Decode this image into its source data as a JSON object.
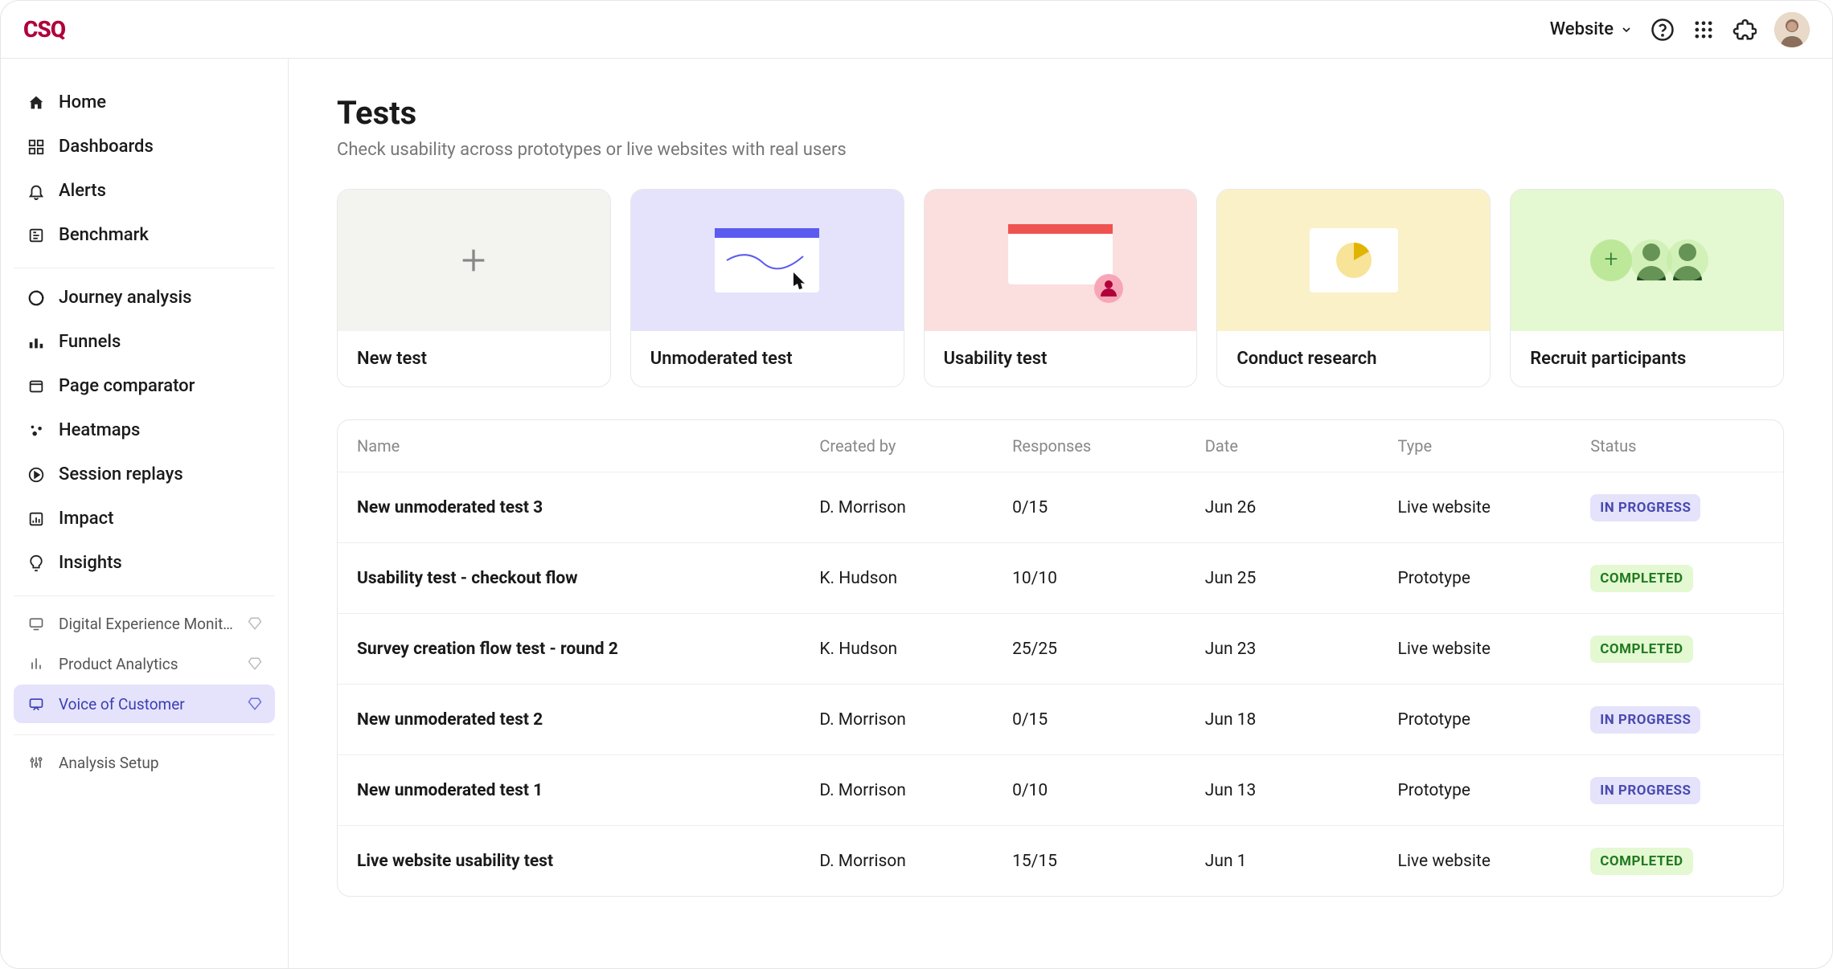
{
  "header": {
    "brand": "CSQ",
    "project_selector": "Website"
  },
  "sidebar": {
    "groups": [
      {
        "items": [
          {
            "id": "home",
            "label": "Home"
          },
          {
            "id": "dashboards",
            "label": "Dashboards"
          },
          {
            "id": "alerts",
            "label": "Alerts"
          },
          {
            "id": "benchmark",
            "label": "Benchmark"
          }
        ]
      },
      {
        "items": [
          {
            "id": "journey-analysis",
            "label": "Journey analysis"
          },
          {
            "id": "funnels",
            "label": "Funnels"
          },
          {
            "id": "page-comparator",
            "label": "Page comparator"
          },
          {
            "id": "heatmaps",
            "label": "Heatmaps"
          },
          {
            "id": "session-replays",
            "label": "Session replays"
          },
          {
            "id": "impact",
            "label": "Impact"
          },
          {
            "id": "insights",
            "label": "Insights"
          }
        ]
      },
      {
        "items": [
          {
            "id": "dem",
            "label": "Digital Experience Monitor...",
            "gem": true
          },
          {
            "id": "product-analytics",
            "label": "Product Analytics",
            "gem": true
          },
          {
            "id": "voc",
            "label": "Voice of Customer",
            "gem": true,
            "active": true
          }
        ],
        "small": true
      },
      {
        "items": [
          {
            "id": "analysis-setup",
            "label": "Analysis Setup"
          }
        ],
        "small": true
      }
    ]
  },
  "page": {
    "title": "Tests",
    "subtitle": "Check usability across prototypes or live websites with real users"
  },
  "cards": [
    {
      "id": "new-test",
      "label": "New test",
      "color": "gray"
    },
    {
      "id": "unmoderated",
      "label": "Unmoderated test",
      "color": "purple"
    },
    {
      "id": "usability",
      "label": "Usability test",
      "color": "pink"
    },
    {
      "id": "research",
      "label": "Conduct research",
      "color": "yellow"
    },
    {
      "id": "recruit",
      "label": "Recruit participants",
      "color": "green"
    }
  ],
  "table": {
    "columns": [
      "Name",
      "Created by",
      "Responses",
      "Date",
      "Type",
      "Status"
    ],
    "rows": [
      {
        "name": "New unmoderated test 3",
        "created_by": "D. Morrison",
        "responses": "0/15",
        "date": "Jun 26",
        "type": "Live website",
        "status": "IN PROGRESS",
        "status_kind": "inprogress"
      },
      {
        "name": "Usability test - checkout flow",
        "created_by": "K. Hudson",
        "responses": "10/10",
        "date": "Jun 25",
        "type": "Prototype",
        "status": "COMPLETED",
        "status_kind": "completed"
      },
      {
        "name": "Survey creation flow test - round 2",
        "created_by": "K. Hudson",
        "responses": "25/25",
        "date": "Jun 23",
        "type": "Live website",
        "status": "COMPLETED",
        "status_kind": "completed"
      },
      {
        "name": "New unmoderated test 2",
        "created_by": "D. Morrison",
        "responses": "0/15",
        "date": "Jun 18",
        "type": "Prototype",
        "status": "IN PROGRESS",
        "status_kind": "inprogress"
      },
      {
        "name": "New unmoderated test 1",
        "created_by": "D. Morrison",
        "responses": "0/10",
        "date": "Jun 13",
        "type": "Prototype",
        "status": "IN PROGRESS",
        "status_kind": "inprogress"
      },
      {
        "name": "Live website usability test",
        "created_by": "D. Morrison",
        "responses": "15/15",
        "date": "Jun 1",
        "type": "Live website",
        "status": "COMPLETED",
        "status_kind": "completed"
      }
    ]
  }
}
